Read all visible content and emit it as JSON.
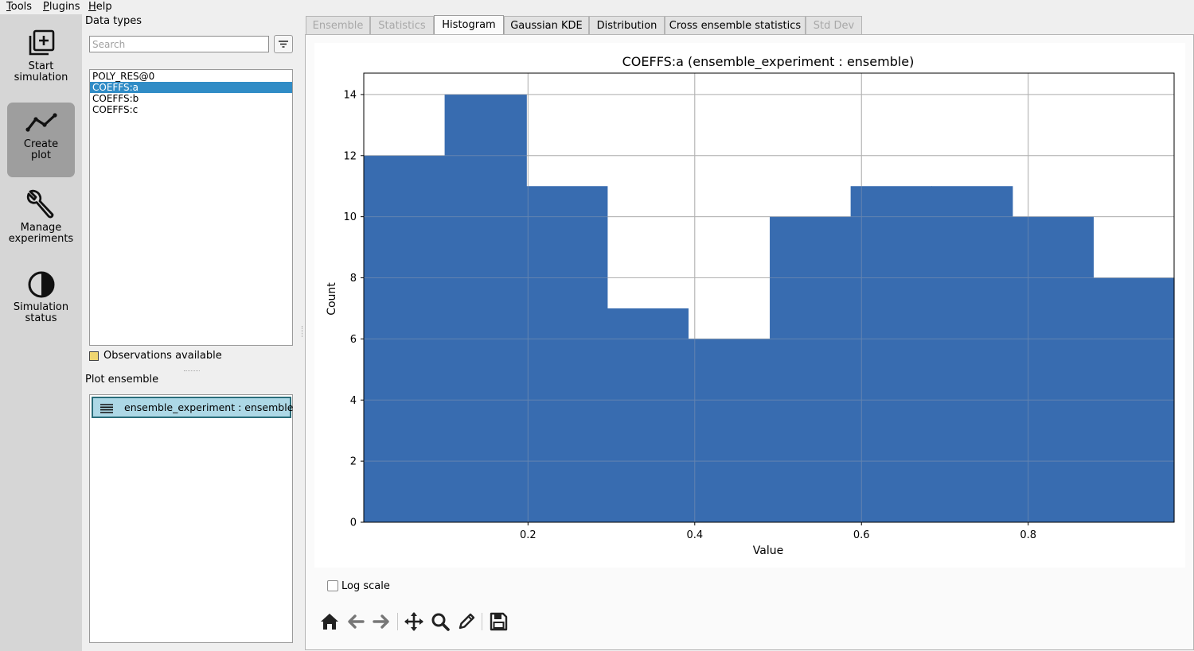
{
  "menubar": {
    "items": [
      "Tools",
      "Plugins",
      "Help"
    ]
  },
  "sidebar": {
    "buttons": [
      {
        "line1": "Start",
        "line2": "simulation",
        "icon": "plus-square-icon"
      },
      {
        "line1": "Create",
        "line2": "plot",
        "icon": "line-plot-icon",
        "active": true
      },
      {
        "line1": "Manage",
        "line2": "experiments",
        "icon": "wrench-icon"
      },
      {
        "line1": "Simulation",
        "line2": "status",
        "icon": "half-circle-icon"
      }
    ]
  },
  "datatypes": {
    "title": "Data types",
    "search_placeholder": "Search",
    "items": [
      "POLY_RES@0",
      "COEFFS:a",
      "COEFFS:b",
      "COEFFS:c"
    ],
    "selected_index": 1,
    "observations_label": "Observations available",
    "observations_color": "#f0d670"
  },
  "plot_ensemble": {
    "title": "Plot ensemble",
    "items": [
      "ensemble_experiment : ensemble"
    ]
  },
  "tabs": [
    {
      "label": "Ensemble",
      "state": "disabled"
    },
    {
      "label": "Statistics",
      "state": "disabled"
    },
    {
      "label": "Histogram",
      "state": "active"
    },
    {
      "label": "Gaussian KDE",
      "state": "normal"
    },
    {
      "label": "Distribution",
      "state": "normal"
    },
    {
      "label": "Cross ensemble statistics",
      "state": "normal"
    },
    {
      "label": "Std Dev",
      "state": "disabled"
    }
  ],
  "chart_data": {
    "type": "bar",
    "title": "COEFFS:a (ensemble_experiment : ensemble)",
    "xlabel": "Value",
    "ylabel": "Count",
    "bar_color": "#386cb0",
    "grid": true,
    "xlim": [
      0.003,
      0.975
    ],
    "ylim": [
      0,
      14.7
    ],
    "xticks": [
      0.2,
      0.4,
      0.6,
      0.8
    ],
    "yticks": [
      0,
      2,
      4,
      6,
      8,
      10,
      12,
      14
    ],
    "bins": [
      {
        "start": 0.003,
        "end": 0.1,
        "count": 12
      },
      {
        "start": 0.1,
        "end": 0.198,
        "count": 14
      },
      {
        "start": 0.198,
        "end": 0.295,
        "count": 11
      },
      {
        "start": 0.295,
        "end": 0.392,
        "count": 7
      },
      {
        "start": 0.392,
        "end": 0.49,
        "count": 6
      },
      {
        "start": 0.49,
        "end": 0.587,
        "count": 10
      },
      {
        "start": 0.587,
        "end": 0.684,
        "count": 11
      },
      {
        "start": 0.684,
        "end": 0.781,
        "count": 11
      },
      {
        "start": 0.781,
        "end": 0.878,
        "count": 10
      },
      {
        "start": 0.878,
        "end": 0.975,
        "count": 8
      }
    ]
  },
  "controls": {
    "log_scale_label": "Log scale",
    "log_scale_checked": false
  },
  "nav_toolbar": [
    "home-icon",
    "back-arrow-icon",
    "forward-arrow-icon",
    "pan-icon",
    "zoom-icon",
    "edit-icon",
    "save-icon"
  ]
}
